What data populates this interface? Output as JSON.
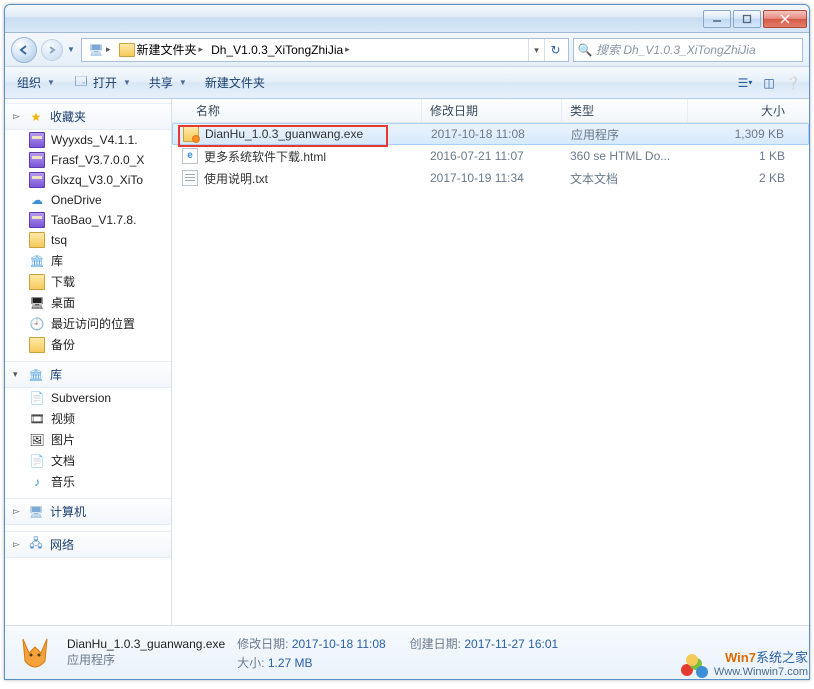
{
  "breadcrumb": {
    "seg1": "新建文件夹",
    "seg2": "Dh_V1.0.3_XiTongZhiJia"
  },
  "search": {
    "placeholder": "搜索 Dh_V1.0.3_XiTongZhiJia"
  },
  "toolbar": {
    "organize": "组织",
    "open": "打开",
    "share": "共享",
    "newfolder": "新建文件夹"
  },
  "columns": {
    "name": "名称",
    "date": "修改日期",
    "type": "类型",
    "size": "大小"
  },
  "sidebar": {
    "fav": "收藏夹",
    "items": [
      "Wyyxds_V4.1.1.",
      "Frasf_V3.7.0.0_X",
      "Glxzq_V3.0_XiTo",
      "OneDrive",
      "TaoBao_V1.7.8.",
      "tsq",
      "库",
      "下载",
      "桌面",
      "最近访问的位置",
      "备份"
    ],
    "lib": "库",
    "libs": [
      "Subversion",
      "视频",
      "图片",
      "文档",
      "音乐"
    ],
    "computer": "计算机",
    "network": "网络"
  },
  "files": [
    {
      "name": "DianHu_1.0.3_guanwang.exe",
      "date": "2017-10-18 11:08",
      "type": "应用程序",
      "size": "1,309 KB"
    },
    {
      "name": "更多系统软件下载.html",
      "date": "2016-07-21 11:07",
      "type": "360 se HTML Do...",
      "size": "1 KB"
    },
    {
      "name": "使用说明.txt",
      "date": "2017-10-19 11:34",
      "type": "文本文档",
      "size": "2 KB"
    }
  ],
  "details": {
    "filename": "DianHu_1.0.3_guanwang.exe",
    "filetype": "应用程序",
    "mod_label": "修改日期:",
    "mod_value": "2017-10-18 11:08",
    "size_label": "大小:",
    "size_value": "1.27 MB",
    "created_label": "创建日期:",
    "created_value": "2017-11-27 16:01"
  },
  "watermark": {
    "line1a": "Win7",
    "line1b": "系统之家",
    "line2": "Www.Winwin7.com"
  }
}
